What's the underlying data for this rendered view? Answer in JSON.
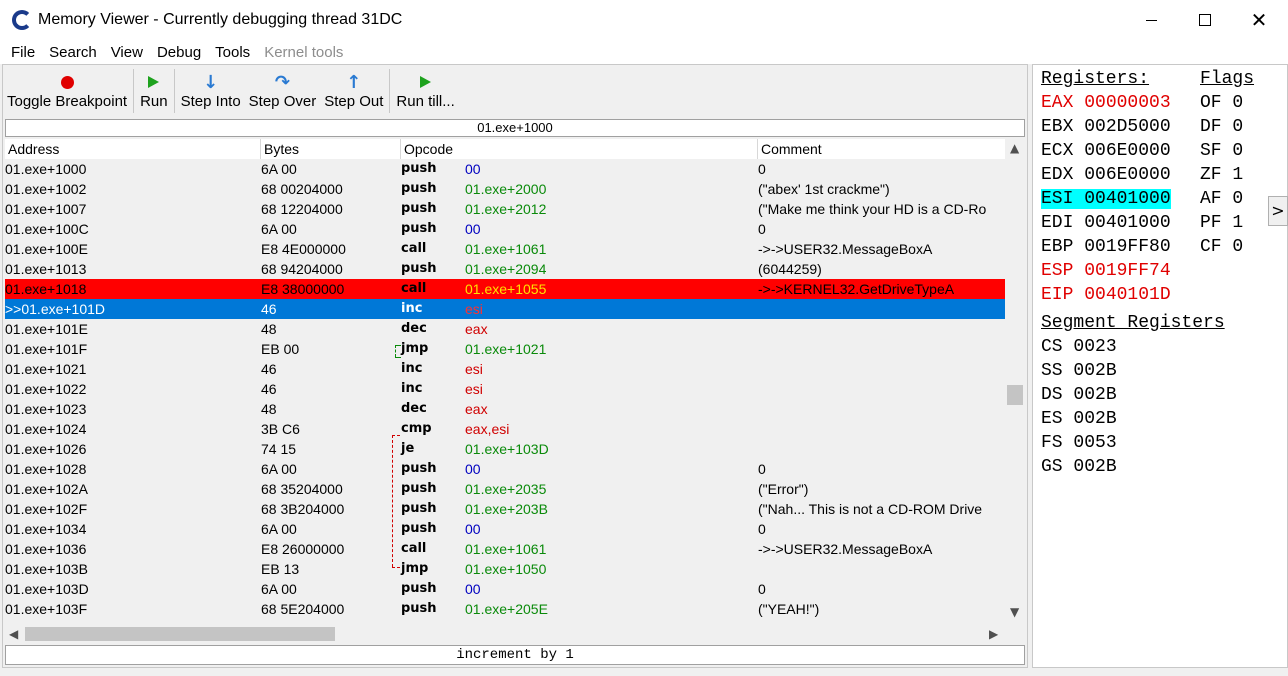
{
  "window": {
    "title": "Memory Viewer - Currently debugging thread 31DC"
  },
  "menu": [
    "File",
    "Search",
    "View",
    "Debug",
    "Tools",
    "Kernel tools"
  ],
  "toolbar": {
    "toggle_breakpoint": "Toggle Breakpoint",
    "run": "Run",
    "step_into": "Step Into",
    "step_over": "Step Over",
    "step_out": "Step Out",
    "run_till": "Run till..."
  },
  "address_bar": "01.exe+1000",
  "columns": {
    "address": "Address",
    "bytes": "Bytes",
    "opcode": "Opcode",
    "comment": "Comment"
  },
  "rows": [
    {
      "addr": "01.exe+1000",
      "bytes": "6A 00",
      "op": "push",
      "arg": "00",
      "argtype": "hex",
      "cmt": "0"
    },
    {
      "addr": "01.exe+1002",
      "bytes": "68 00204000",
      "op": "push",
      "arg": "01.exe+2000",
      "argtype": "addr",
      "cmt": "(\"abex' 1st crackme\")"
    },
    {
      "addr": "01.exe+1007",
      "bytes": "68 12204000",
      "op": "push",
      "arg": "01.exe+2012",
      "argtype": "addr",
      "cmt": "(\"Make me think your HD is a CD-Ro"
    },
    {
      "addr": "01.exe+100C",
      "bytes": "6A 00",
      "op": "push",
      "arg": "00",
      "argtype": "hex",
      "cmt": "0"
    },
    {
      "addr": "01.exe+100E",
      "bytes": "E8 4E000000",
      "op": "call",
      "arg": "01.exe+1061",
      "argtype": "addr",
      "cmt": "->->USER32.MessageBoxA"
    },
    {
      "addr": "01.exe+1013",
      "bytes": "68 94204000",
      "op": "push",
      "arg": "01.exe+2094",
      "argtype": "addr",
      "cmt": "(6044259)"
    },
    {
      "addr": "01.exe+1018",
      "bytes": "E8 38000000",
      "op": "call",
      "arg": "01.exe+1055",
      "argtype": "addr",
      "cmt": "->->KERNEL32.GetDriveTypeA",
      "state": "bp"
    },
    {
      "addr": ">>01.exe+101D",
      "bytes": "46",
      "op": "inc",
      "arg": "esi",
      "argtype": "reg",
      "cmt": "",
      "state": "sel"
    },
    {
      "addr": "01.exe+101E",
      "bytes": "48",
      "op": "dec",
      "arg": "eax",
      "argtype": "reg",
      "cmt": ""
    },
    {
      "addr": "01.exe+101F",
      "bytes": "EB 00",
      "op": "jmp",
      "arg": "01.exe+1021",
      "argtype": "addr",
      "cmt": ""
    },
    {
      "addr": "01.exe+1021",
      "bytes": "46",
      "op": "inc",
      "arg": "esi",
      "argtype": "reg",
      "cmt": ""
    },
    {
      "addr": "01.exe+1022",
      "bytes": "46",
      "op": "inc",
      "arg": "esi",
      "argtype": "reg",
      "cmt": ""
    },
    {
      "addr": "01.exe+1023",
      "bytes": "48",
      "op": "dec",
      "arg": "eax",
      "argtype": "reg",
      "cmt": ""
    },
    {
      "addr": "01.exe+1024",
      "bytes": "3B C6",
      "op": "cmp",
      "arg": "eax,esi",
      "argtype": "reg",
      "cmt": ""
    },
    {
      "addr": "01.exe+1026",
      "bytes": "74 15",
      "op": "je",
      "arg": "01.exe+103D",
      "argtype": "addr",
      "cmt": ""
    },
    {
      "addr": "01.exe+1028",
      "bytes": "6A 00",
      "op": "push",
      "arg": "00",
      "argtype": "hex",
      "cmt": "0"
    },
    {
      "addr": "01.exe+102A",
      "bytes": "68 35204000",
      "op": "push",
      "arg": "01.exe+2035",
      "argtype": "addr",
      "cmt": "(\"Error\")"
    },
    {
      "addr": "01.exe+102F",
      "bytes": "68 3B204000",
      "op": "push",
      "arg": "01.exe+203B",
      "argtype": "addr",
      "cmt": "(\"Nah... This is not a CD-ROM Drive"
    },
    {
      "addr": "01.exe+1034",
      "bytes": "6A 00",
      "op": "push",
      "arg": "00",
      "argtype": "hex",
      "cmt": "0"
    },
    {
      "addr": "01.exe+1036",
      "bytes": "E8 26000000",
      "op": "call",
      "arg": "01.exe+1061",
      "argtype": "addr",
      "cmt": "->->USER32.MessageBoxA"
    },
    {
      "addr": "01.exe+103B",
      "bytes": "EB 13",
      "op": "jmp",
      "arg": "01.exe+1050",
      "argtype": "addr",
      "cmt": ""
    },
    {
      "addr": "01.exe+103D",
      "bytes": "6A 00",
      "op": "push",
      "arg": "00",
      "argtype": "hex",
      "cmt": "0"
    },
    {
      "addr": "01.exe+103F",
      "bytes": "68 5E204000",
      "op": "push",
      "arg": "01.exe+205E",
      "argtype": "addr",
      "cmt": "(\"YEAH!\")"
    }
  ],
  "status": "increment by 1",
  "registers": {
    "header": "Registers:",
    "items": [
      {
        "name": "EAX",
        "value": "00000003",
        "style": "red"
      },
      {
        "name": "EBX",
        "value": "002D5000",
        "style": ""
      },
      {
        "name": "ECX",
        "value": "006E0000",
        "style": ""
      },
      {
        "name": "EDX",
        "value": "006E0000",
        "style": ""
      },
      {
        "name": "ESI",
        "value": "00401000",
        "style": "hl"
      },
      {
        "name": "EDI",
        "value": "00401000",
        "style": ""
      },
      {
        "name": "EBP",
        "value": "0019FF80",
        "style": ""
      },
      {
        "name": "ESP",
        "value": "0019FF74",
        "style": "red"
      },
      {
        "name": "EIP",
        "value": "0040101D",
        "style": "red"
      }
    ]
  },
  "flags": {
    "header": "Flags",
    "items": [
      {
        "name": "OF",
        "value": "0"
      },
      {
        "name": "DF",
        "value": "0"
      },
      {
        "name": "SF",
        "value": "0"
      },
      {
        "name": "ZF",
        "value": "1"
      },
      {
        "name": "AF",
        "value": "0"
      },
      {
        "name": "PF",
        "value": "1"
      },
      {
        "name": "CF",
        "value": "0"
      }
    ]
  },
  "segments": {
    "header": "Segment Registers",
    "items": [
      {
        "name": "CS",
        "value": "0023"
      },
      {
        "name": "SS",
        "value": "002B"
      },
      {
        "name": "DS",
        "value": "002B"
      },
      {
        "name": "ES",
        "value": "002B"
      },
      {
        "name": "FS",
        "value": "0053"
      },
      {
        "name": "GS",
        "value": "002B"
      }
    ]
  },
  "expand_button": ">"
}
